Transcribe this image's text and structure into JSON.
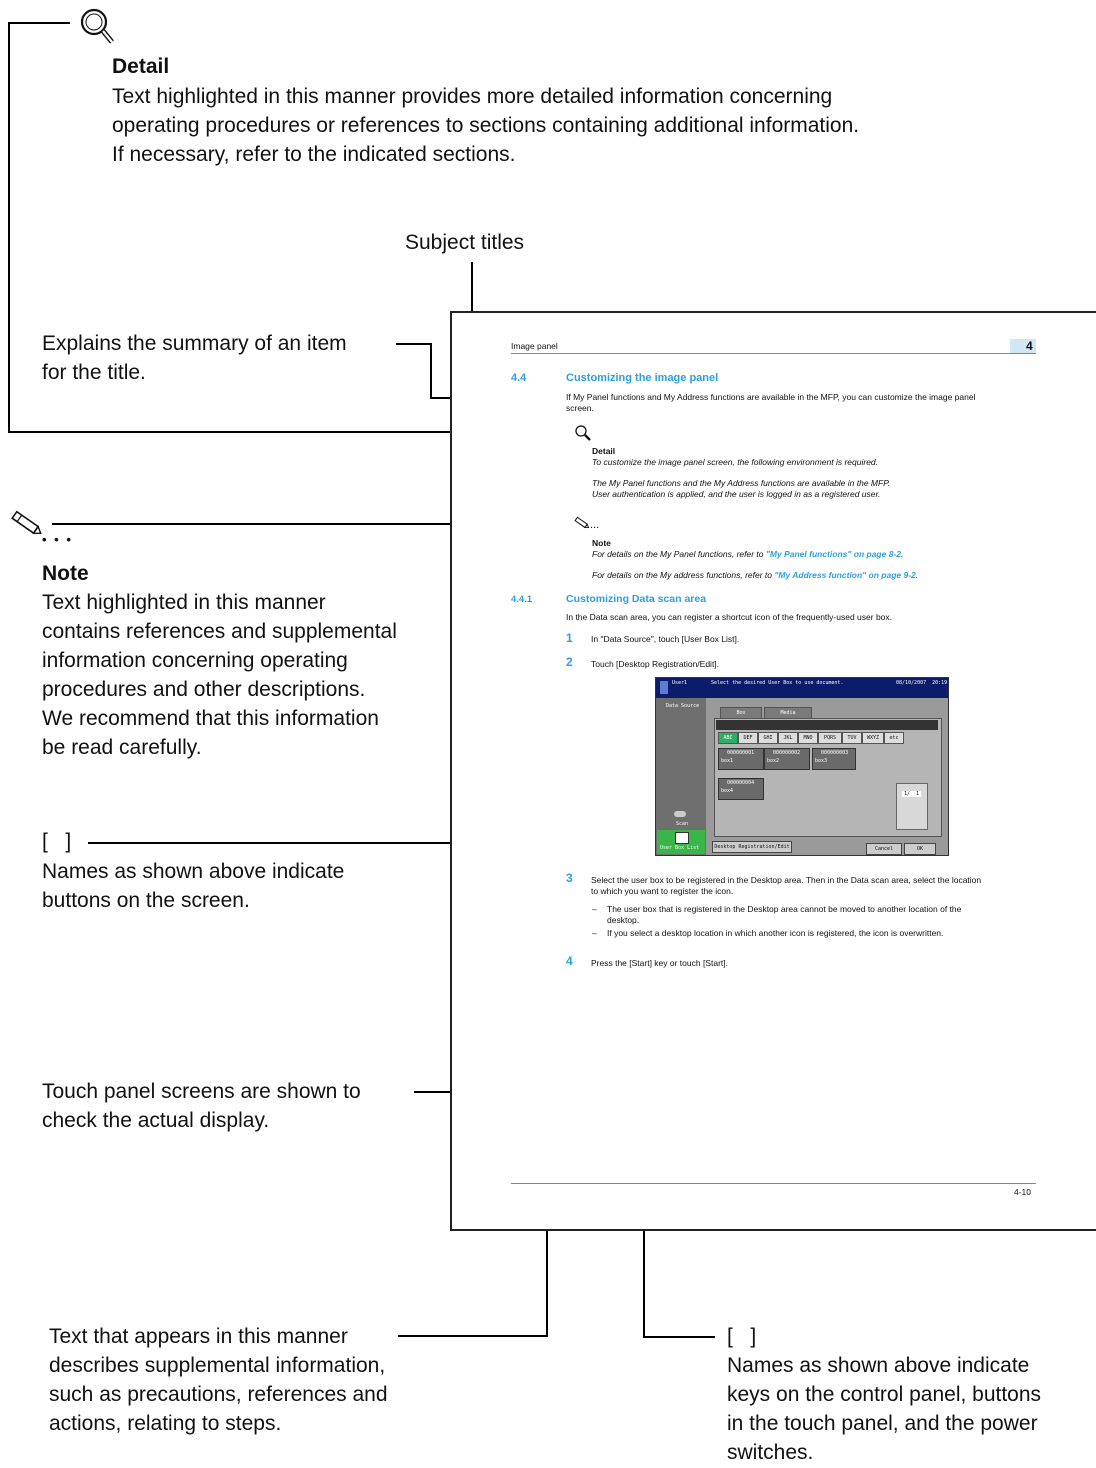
{
  "detail_callout": {
    "icon": "magnifier-icon",
    "heading": "Detail",
    "lines": [
      "Text highlighted in this manner provides more detailed information concerning",
      "operating procedures or references to sections containing additional information.",
      "If necessary, refer to the indicated sections."
    ]
  },
  "subject_titles_label": "Subject titles",
  "summary_label": {
    "lines": [
      "Explains the summary of an item",
      "for  the title."
    ]
  },
  "note_callout": {
    "icon": "pencil-icon",
    "dots": "• • •",
    "heading": "Note",
    "lines": [
      "Text highlighted in this manner",
      "contains references and supplemental",
      "information concerning operating",
      "procedures and other descriptions.",
      "We recommend that this information",
      "be read carefully."
    ]
  },
  "brackets_screen_callout": {
    "bracket": "[   ]",
    "lines": [
      "Names as shown above indicate",
      "buttons on the screen."
    ]
  },
  "touch_panel_callout": {
    "lines": [
      "Touch panel screens are shown to",
      "check the actual display."
    ]
  },
  "supplemental_callout": {
    "lines": [
      "Text that appears in this manner",
      "describes supplemental information,",
      "such as precautions, references and",
      "actions, relating to steps."
    ]
  },
  "brackets_keys_callout": {
    "bracket": "[   ]",
    "lines": [
      "Names as shown above indicate",
      "keys on the control panel, buttons",
      "in the touch panel, and the power",
      "switches."
    ]
  },
  "doc": {
    "header_title": "Image panel",
    "chapter_number": "4",
    "section_number": "4.4",
    "section_title": "Customizing the image panel",
    "section_intro_1": "If My Panel functions and My Address functions are available in the MFP, you can customize the image panel",
    "section_intro_2": "screen.",
    "detail_heading": "Detail",
    "detail_line1": "To customize the image panel screen, the following environment is required.",
    "detail_line2": "The My Panel functions and the My Address functions are available in the MFP.",
    "detail_line3": "User authentication is applied, and the user is logged in as a registered user.",
    "note_dots": "...",
    "note_heading": "Note",
    "note_line1_pre": "For details on the My Panel functions, refer to ",
    "note_line1_link": "\"My Panel functions\" on page 8-2",
    "note_line1_post": ".",
    "note_line2_pre": "For details on the My address functions, refer to ",
    "note_line2_link": "\"My Address function\" on page 9-2",
    "note_line2_post": ".",
    "subsection_number": "4.4.1",
    "subsection_title": "Customizing Data scan area",
    "subsection_intro": "In the Data scan area, you can register a shortcut icon of the frequently-used user box.",
    "steps": [
      {
        "num": "1",
        "text": "In \"Data Source\", touch [User Box List]."
      },
      {
        "num": "2",
        "text": "Touch [Desktop Registration/Edit]."
      },
      {
        "num": "3",
        "text": "Select the user box to be registered in the Desktop area. Then in the Data scan area, select the location"
      },
      {
        "num": "4",
        "text": "Press the [Start] key or touch [Start]."
      }
    ],
    "step3_line2": "to which you want to register the icon.",
    "bullets": [
      "The user box that is registered in the Desktop area cannot be moved to another location of the",
      "desktop.",
      "If you select a desktop location in which another icon is registered, the icon is overwritten."
    ],
    "bullet_dash": "–",
    "footer_page": "4-10"
  },
  "touch_panel": {
    "user": "User1",
    "message": "Select the desired User Box to use document.",
    "datetime": "08/10/2007  20:19",
    "data_source": "Data Source",
    "tabs": [
      "Box",
      "Media"
    ],
    "letters": [
      "ABC",
      "DEF",
      "GHI",
      "JKL",
      "MNO",
      "PQRS",
      "TUV",
      "WXYZ",
      "etc"
    ],
    "boxes": [
      {
        "id": "000000001",
        "name": "box1"
      },
      {
        "id": "000000002",
        "name": "box2"
      },
      {
        "id": "000000003",
        "name": "box3"
      },
      {
        "id": "000000004",
        "name": "box4"
      }
    ],
    "page_counter": "1/  1",
    "scan_label": "Scan",
    "user_box_list": "User Box List",
    "desktop_btn": "Desktop Registration/Edit",
    "cancel": "Cancel",
    "ok": "OK",
    "colors": {
      "header": "#0d1b6b",
      "accent_green": "#39b54a",
      "selected_letter": "#2fae6a"
    }
  },
  "colors": {
    "accent_blue": "#2aa0df",
    "link_blue": "#2aa0df"
  }
}
